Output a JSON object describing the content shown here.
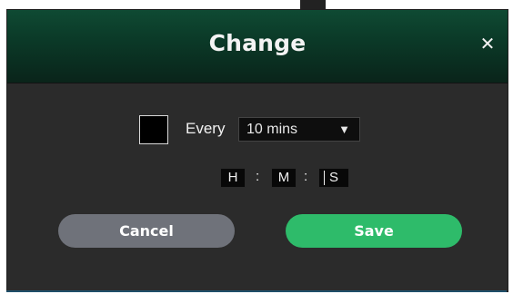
{
  "dialog": {
    "title": "Change",
    "close_icon": "✕",
    "every_label": "Every",
    "interval": {
      "selected": "10 mins",
      "caret_icon": "▼"
    },
    "time": {
      "hours": "H",
      "minutes": "M",
      "seconds": "S",
      "separator": ":"
    },
    "buttons": {
      "cancel": "Cancel",
      "save": "Save"
    }
  },
  "colors": {
    "header_top": "#0f4a33",
    "header_bottom": "#0a241a",
    "body": "#2b2b2b",
    "cancel": "#6f727a",
    "save": "#2ebb6a"
  }
}
